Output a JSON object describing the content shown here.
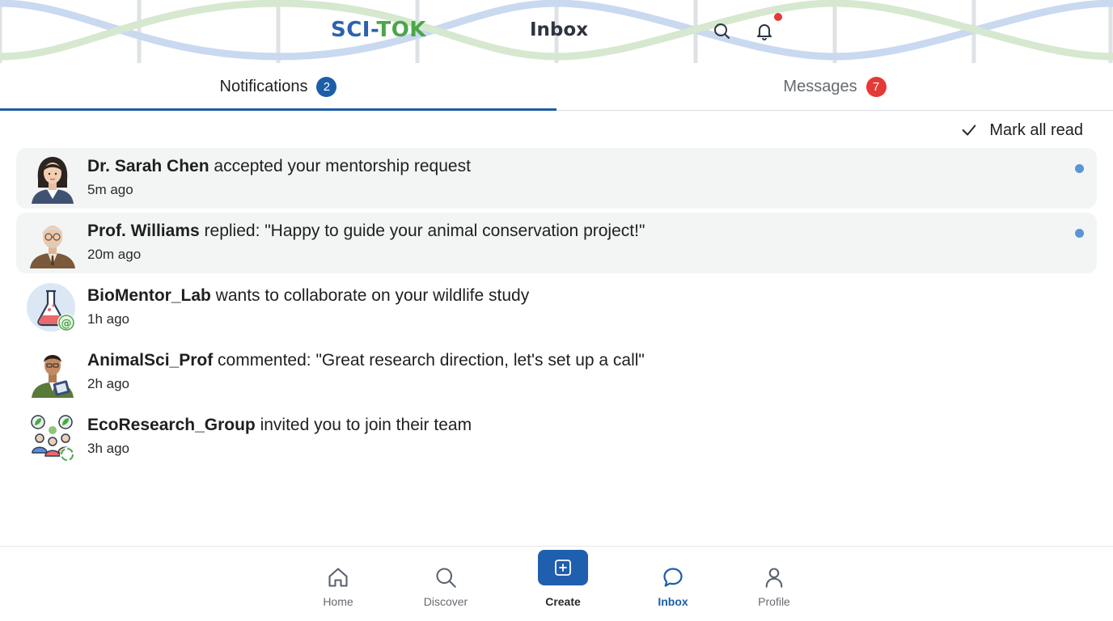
{
  "header": {
    "brand_part1": "SCI",
    "brand_part2": "-",
    "brand_part3": "TOK",
    "title": "Inbox",
    "icons": [
      "search-icon",
      "bell-icon"
    ],
    "colors": {
      "brand_blue": "#2a62ad",
      "brand_green": "#4aa64a",
      "notification_dot": "#e53935"
    }
  },
  "tabs": [
    {
      "label": "Notifications",
      "badge": "2",
      "active": true,
      "badge_color": "#1d5ea8"
    },
    {
      "label": "Messages",
      "badge": "7",
      "active": false,
      "badge_color": "#e53935"
    }
  ],
  "actions": {
    "mark_all_read": "Mark all read",
    "icon": "check-icon"
  },
  "notifications": [
    {
      "actor": "Dr. Sarah Chen",
      "text": " accepted your mentorship request",
      "time": "5m ago",
      "unread": true,
      "avatar": "woman-avatar"
    },
    {
      "actor": "Prof. Williams",
      "text": " replied: \"Happy to guide your animal conservation project!\"",
      "time": "20m ago",
      "unread": true,
      "avatar": "elderly-man-avatar"
    },
    {
      "actor": "BioMentor_Lab",
      "text": " wants to collaborate on your wildlife study",
      "time": "1h ago",
      "unread": false,
      "avatar": "flask-avatar"
    },
    {
      "actor": "AnimalSci_Prof",
      "text": " commented: \"Great research direction, let's set up a call\"",
      "time": "2h ago",
      "unread": false,
      "avatar": "man-clipboard-avatar"
    },
    {
      "actor": "EcoResearch_Group",
      "text": " invited you to join their team",
      "time": "3h ago",
      "unread": false,
      "avatar": "group-leaf-avatar"
    }
  ],
  "bottom_nav": [
    {
      "label": "Home",
      "icon": "home-icon",
      "active": false
    },
    {
      "label": "Discover",
      "icon": "search-icon",
      "active": false
    },
    {
      "label": "Create",
      "icon": "plus-square-icon",
      "active": false
    },
    {
      "label": "Inbox",
      "icon": "chat-bubble-icon",
      "active": true
    },
    {
      "label": "Profile",
      "icon": "person-icon",
      "active": false
    }
  ],
  "colors": {
    "accent": "#1d5ea8",
    "unread_dot": "#5b95d6",
    "unread_bg": "#f3f5f5"
  }
}
